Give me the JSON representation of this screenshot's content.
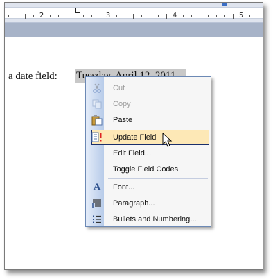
{
  "ruler": {
    "numbers": [
      "2",
      "3",
      "4",
      "5"
    ]
  },
  "document": {
    "prefix_text": "a date field:",
    "field_value": "Tuesday, April 12, 2011"
  },
  "context_menu": {
    "items": [
      {
        "label": "Cut",
        "icon": "scissors-icon",
        "enabled": false
      },
      {
        "label": "Copy",
        "icon": "copy-icon",
        "enabled": false
      },
      {
        "label": "Paste",
        "icon": "paste-icon",
        "enabled": true
      },
      {
        "label": "Update Field",
        "icon": "update-field-icon",
        "enabled": true,
        "highlighted": true
      },
      {
        "label": "Edit Field...",
        "icon": "",
        "enabled": true
      },
      {
        "label": "Toggle Field Codes",
        "icon": "",
        "enabled": true
      },
      {
        "label": "Font...",
        "icon": "font-icon",
        "enabled": true
      },
      {
        "label": "Paragraph...",
        "icon": "paragraph-icon",
        "enabled": true
      },
      {
        "label": "Bullets and Numbering...",
        "icon": "bullets-icon",
        "enabled": true
      }
    ]
  },
  "colors": {
    "menu_highlight": "#fde8b6",
    "menu_border": "#6c89b5",
    "field_shading": "#c8c8c8"
  }
}
